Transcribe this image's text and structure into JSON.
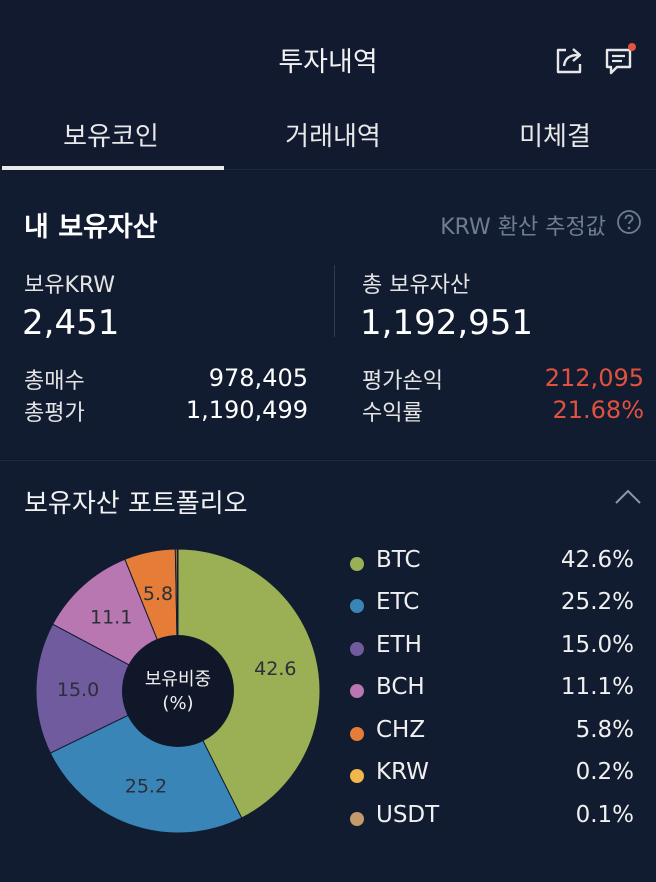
{
  "header": {
    "title": "투자내역"
  },
  "tabs": [
    {
      "label": "보유코인"
    },
    {
      "label": "거래내역"
    },
    {
      "label": "미체결"
    }
  ],
  "assets": {
    "title": "내 보유자산",
    "note": "KRW 환산 추정값",
    "krw_label": "보유KRW",
    "krw_value": "2,451",
    "total_label": "총 보유자산",
    "total_value": "1,192,951",
    "buy_label": "총매수",
    "buy_value": "978,405",
    "eval_label": "총평가",
    "eval_value": "1,190,499",
    "pnl_label": "평가손익",
    "pnl_value": "212,095",
    "roi_label": "수익률",
    "roi_value": "21.68%"
  },
  "portfolio": {
    "title": "보유자산 포트폴리오",
    "center_line1": "보유비중",
    "center_line2": "(%)",
    "items": [
      {
        "name": "BTC",
        "pct": "42.6%",
        "value": 42.6,
        "label": "42.6",
        "color": "#9bb055"
      },
      {
        "name": "ETC",
        "pct": "25.2%",
        "value": 25.2,
        "label": "25.2",
        "color": "#3a85b8"
      },
      {
        "name": "ETH",
        "pct": "15.0%",
        "value": 15.0,
        "label": "15.0",
        "color": "#6f5b9e"
      },
      {
        "name": "BCH",
        "pct": "11.1%",
        "value": 11.1,
        "label": "11.1",
        "color": "#b877b0"
      },
      {
        "name": "CHZ",
        "pct": "5.8%",
        "value": 5.8,
        "label": "5.8",
        "color": "#e57c38"
      },
      {
        "name": "KRW",
        "pct": "0.2%",
        "value": 0.2,
        "label": "",
        "color": "#f2b74a"
      },
      {
        "name": "USDT",
        "pct": "0.1%",
        "value": 0.1,
        "label": "",
        "color": "#c49a6c"
      }
    ]
  }
}
